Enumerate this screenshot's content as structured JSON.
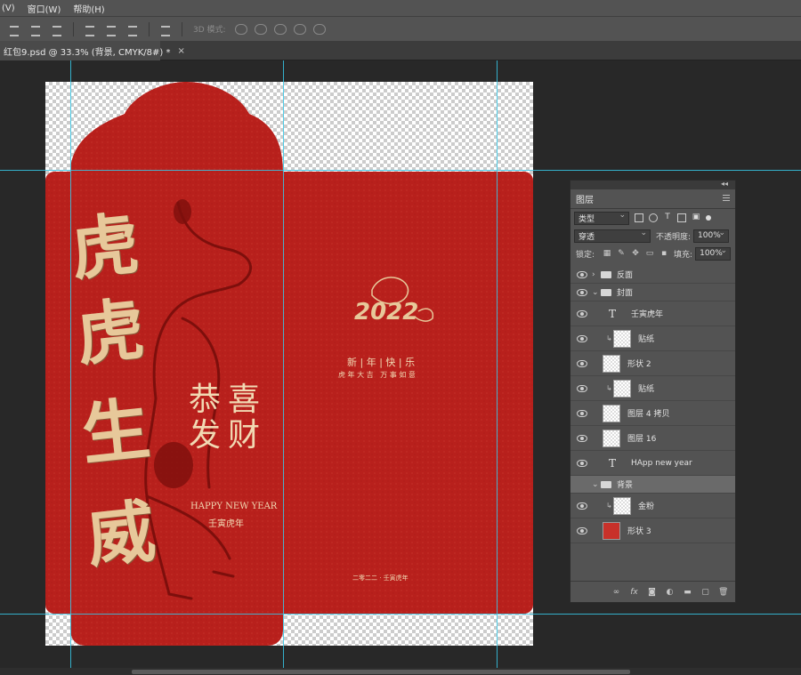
{
  "menubar": {
    "items": [
      "(V)",
      "窗口(W)",
      "帮助(H)"
    ]
  },
  "optionsbar": {
    "mode_label": "3D 模式:"
  },
  "document_tab": {
    "title": "红包9.psd @ 33.3% (背景, CMYK/8#) *",
    "close": "×"
  },
  "artwork": {
    "colors": {
      "red": "#b8201c",
      "gold": "#e7c89a"
    },
    "front_chars": [
      "虎",
      "虎",
      "生",
      "威"
    ],
    "blessing": [
      "恭",
      "喜",
      "发",
      "财"
    ],
    "happy_new_year": "HAPPY NEW YEAR",
    "year_text": "壬寅虎年",
    "year_2022": "2022",
    "greeting": "新 | 年 | 快 | 乐",
    "sub_greeting": "虎 年 大 吉   万 事 如 意",
    "footer_date": "二零二二 · 壬寅虎年"
  },
  "layers_panel": {
    "title": "图层",
    "filter_kind": "类型",
    "blend_mode": "穿透",
    "opacity_label": "不透明度:",
    "opacity_value": "100%",
    "lock_label": "锁定:",
    "fill_label": "填充:",
    "fill_value": "100%",
    "layers": [
      {
        "name": "反面",
        "kind": "group",
        "twisty": "›"
      },
      {
        "name": "封面",
        "kind": "group",
        "twisty": "⌄"
      },
      {
        "name": "壬寅虎年",
        "kind": "text"
      },
      {
        "name": "贴纸",
        "kind": "smart"
      },
      {
        "name": "形状 2",
        "kind": "shape"
      },
      {
        "name": "贴纸",
        "kind": "smart"
      },
      {
        "name": "图层 4 拷贝",
        "kind": "pixel"
      },
      {
        "name": "图层 16",
        "kind": "pixel"
      },
      {
        "name": "HApp new year",
        "kind": "text"
      },
      {
        "name": "背景",
        "kind": "group",
        "twisty": "⌄"
      },
      {
        "name": "金粉",
        "kind": "pixel"
      },
      {
        "name": "形状 3",
        "kind": "shape"
      }
    ],
    "footer_icons": [
      "link-icon",
      "fx-icon",
      "mask-icon",
      "adjustment-icon",
      "folder-icon",
      "new-layer-icon",
      "trash-icon"
    ]
  }
}
